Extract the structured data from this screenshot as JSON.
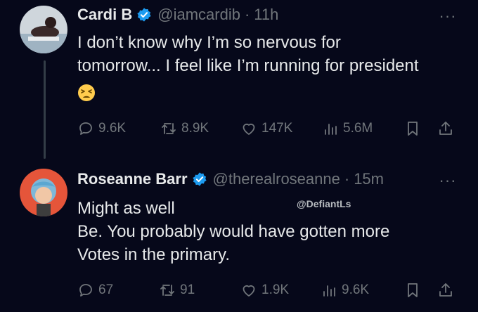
{
  "colors": {
    "background": "#06081a",
    "text": "#e7e9ea",
    "muted": "#71767b",
    "verified": "#1d9bf0"
  },
  "tweets": [
    {
      "display_name": "Cardi B",
      "handle": "@iamcardib",
      "separator": "·",
      "time": "11h",
      "more": "···",
      "text_lines": [
        "I don’t know why I’m so nervous for",
        "tomorrow... I feel like I’m running for president"
      ],
      "emoji": "tired-face-emoji",
      "replies": "9.6K",
      "retweets": "8.9K",
      "likes": "147K",
      "views": "5.6M"
    },
    {
      "display_name": "Roseanne Barr",
      "handle": "@therealroseanne",
      "separator": "·",
      "time": "15m",
      "more": "···",
      "text_lines": [
        "Might as well",
        "Be. You probably would have gotten more",
        "Votes in the primary."
      ],
      "replies": "67",
      "retweets": "91",
      "likes": "1.9K",
      "views": "9.6K"
    }
  ],
  "watermark": "@DefiantLs"
}
